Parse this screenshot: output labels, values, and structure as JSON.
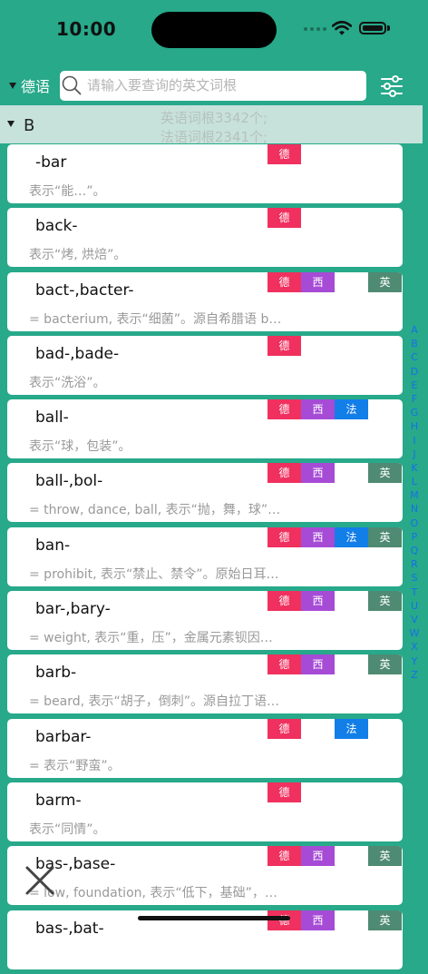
{
  "status_bar": {
    "time": "10:00"
  },
  "toolbar": {
    "language": "德语",
    "search_placeholder": "请输入要查询的英文词根",
    "search_value": ""
  },
  "section": {
    "letter": "B",
    "stats_en": "英语词根3342个;",
    "stats_fr": "法语词根2341个;"
  },
  "badge_labels": {
    "de": "德",
    "es": "西",
    "fr": "法",
    "en": "英"
  },
  "colors": {
    "background": "#27a98a",
    "de": "#f0305e",
    "es": "#a64bd6",
    "fr": "#127ee8",
    "en": "#4f8a73"
  },
  "entries": [
    {
      "title": "-bar",
      "desc": "表示“能…”。",
      "tags": [
        "de"
      ]
    },
    {
      "title": "back-",
      "desc": "表示“烤, 烘焙”。",
      "tags": [
        "de"
      ]
    },
    {
      "title": "bact-,bacter-",
      "desc": "= bacterium, 表示“细菌”。源自希腊语 b…",
      "tags": [
        "de",
        "es",
        "en"
      ]
    },
    {
      "title": "bad-,bade-",
      "desc": "表示“洗浴”。",
      "tags": [
        "de"
      ]
    },
    {
      "title": "ball-",
      "desc": "表示“球，包装”。",
      "tags": [
        "de",
        "es",
        "fr"
      ]
    },
    {
      "title": "ball-,bol-",
      "desc": "= throw, dance, ball, 表示“抛，舞，球”…",
      "tags": [
        "de",
        "es",
        "en"
      ]
    },
    {
      "title": "ban-",
      "desc": "= prohibit, 表示“禁止、禁令”。原始日耳…",
      "tags": [
        "de",
        "es",
        "fr",
        "en"
      ]
    },
    {
      "title": "bar-,bary-",
      "desc": "= weight, 表示“重，压”，金属元素钡因…",
      "tags": [
        "de",
        "es",
        "en"
      ]
    },
    {
      "title": "barb-",
      "desc": "= beard, 表示“胡子，倒刺”。源自拉丁语…",
      "tags": [
        "de",
        "es",
        "en"
      ]
    },
    {
      "title": "barbar-",
      "desc": "= 表示“野蛮”。",
      "tags": [
        "de",
        "fr"
      ]
    },
    {
      "title": "barm-",
      "desc": "表示“同情”。",
      "tags": [
        "de"
      ]
    },
    {
      "title": "bas-,base-",
      "desc": "= low, foundation, 表示“低下，基础”，…",
      "tags": [
        "de",
        "es",
        "en"
      ]
    },
    {
      "title": "bas-,bat-",
      "desc": "",
      "tags": [
        "de",
        "es",
        "en"
      ]
    }
  ],
  "alphabet": [
    "A",
    "B",
    "C",
    "D",
    "E",
    "F",
    "G",
    "H",
    "I",
    "J",
    "K",
    "L",
    "M",
    "N",
    "O",
    "P",
    "Q",
    "R",
    "S",
    "T",
    "U",
    "V",
    "W",
    "X",
    "Y",
    "Z"
  ],
  "icons": {
    "search": "search-icon",
    "filter": "sliders-icon",
    "close": "close-icon",
    "wifi": "wifi-icon",
    "battery": "battery-icon"
  }
}
